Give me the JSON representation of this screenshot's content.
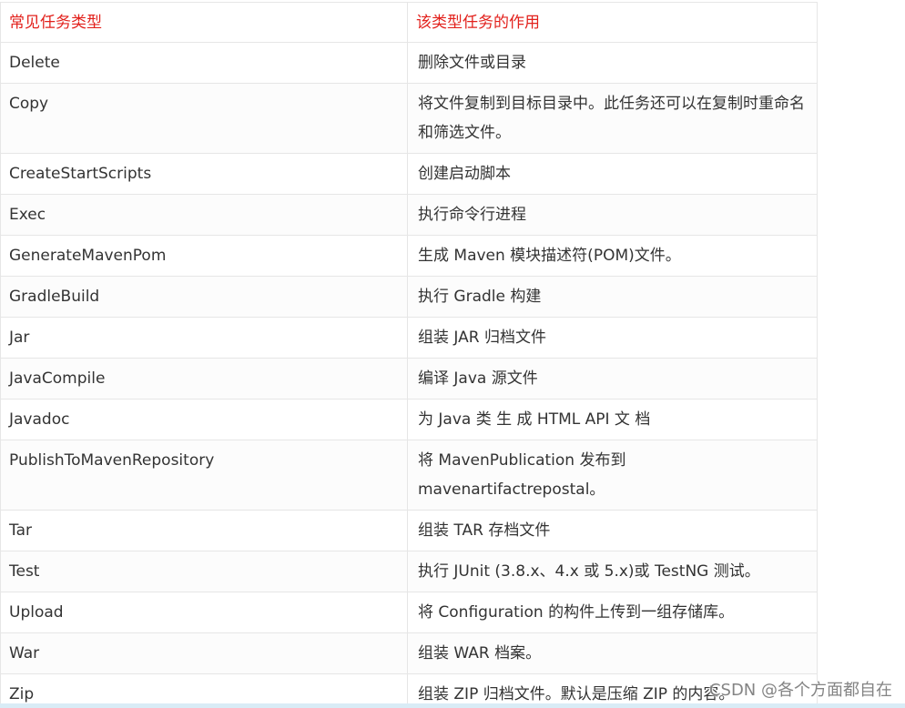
{
  "table": {
    "headers": [
      "常见任务类型",
      "该类型任务的作用"
    ],
    "rows": [
      {
        "type": "Delete",
        "desc": "删除文件或目录"
      },
      {
        "type": "Copy",
        "desc": "将文件复制到目标目录中。此任务还可以在复制时重命名和筛选文件。"
      },
      {
        "type": "CreateStartScripts",
        "desc": "创建启动脚本"
      },
      {
        "type": "Exec",
        "desc": "执行命令行进程"
      },
      {
        "type": "GenerateMavenPom",
        "desc": "生成 Maven 模块描述符(POM)文件。"
      },
      {
        "type": "GradleBuild",
        "desc": "执行 Gradle 构建"
      },
      {
        "type": "Jar",
        "desc": "组装 JAR 归档文件"
      },
      {
        "type": "JavaCompile",
        "desc": "编译 Java 源文件"
      },
      {
        "type": "Javadoc",
        "desc": "为 Java 类 生 成 HTML API 文 档"
      },
      {
        "type": "PublishToMavenRepository",
        "desc": "将 MavenPublication  发布到 mavenartifactrepostal。"
      },
      {
        "type": "Tar",
        "desc": "组装 TAR 存档文件"
      },
      {
        "type": "Test",
        "desc": "执行 JUnit (3.8.x、4.x 或 5.x)或 TestNG 测试。"
      },
      {
        "type": "Upload",
        "desc": "将 Configuration 的构件上传到一组存储库。"
      },
      {
        "type": "War",
        "desc": "组装 WAR 档案。"
      },
      {
        "type": "Zip",
        "desc": "组装 ZIP 归档文件。默认是压缩 ZIP 的内容。"
      }
    ]
  },
  "watermark": "CSDN @各个方面都自在",
  "colors": {
    "header_text": "#e2211c",
    "body_text": "#333333",
    "border": "#e6e6e6"
  }
}
